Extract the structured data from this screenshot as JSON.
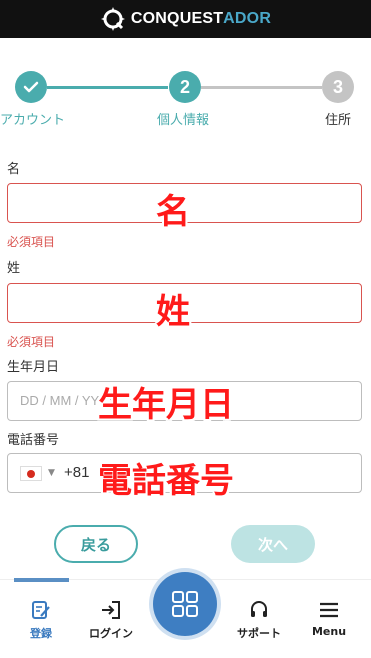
{
  "header": {
    "logo_part1": "CONQUEST",
    "logo_part2": "ADOR"
  },
  "stepper": {
    "steps": [
      {
        "number": "✓",
        "label": "アカウント",
        "state": "done"
      },
      {
        "number": "2",
        "label": "個人情報",
        "state": "current"
      },
      {
        "number": "3",
        "label": "住所",
        "state": "upcoming"
      }
    ],
    "colors": {
      "active": "#4aacad",
      "inactive": "#c4c4c4"
    }
  },
  "form": {
    "first_name": {
      "label": "名",
      "value": "",
      "error": "必須項目",
      "annotation": "名"
    },
    "last_name": {
      "label": "姓",
      "value": "",
      "error": "必須項目",
      "annotation": "姓"
    },
    "birthdate": {
      "label": "生年月日",
      "placeholder": "DD / MM / YYYY",
      "annotation": "生年月日"
    },
    "phone": {
      "label": "電話番号",
      "country_code": "+81",
      "annotation": "電話番号"
    }
  },
  "buttons": {
    "back": "戻る",
    "next": "次へ"
  },
  "bottom_nav": {
    "register": "登録",
    "login": "ログイン",
    "support": "サポート",
    "menu": "Menu"
  }
}
